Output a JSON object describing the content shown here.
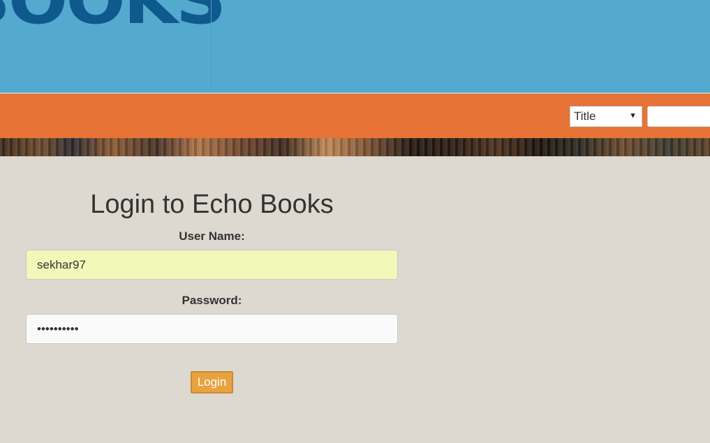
{
  "header": {
    "logo_text": "BOOKS"
  },
  "navbar": {
    "search_field_option": "Title",
    "search_placeholder": ""
  },
  "login": {
    "title": "Login to Echo Books",
    "username_label": "User Name:",
    "username_value": "sekhar97",
    "password_label": "Password:",
    "password_value": "••••••••••",
    "button_label": "Login"
  },
  "colors": {
    "header_blue": "#54a9cf",
    "logo_blue": "#0e5a8d",
    "navbar_orange": "#e77337",
    "content_bg": "#ddd8d0",
    "username_autofill": "#f2f8b8",
    "button_orange": "#e8a23f"
  }
}
